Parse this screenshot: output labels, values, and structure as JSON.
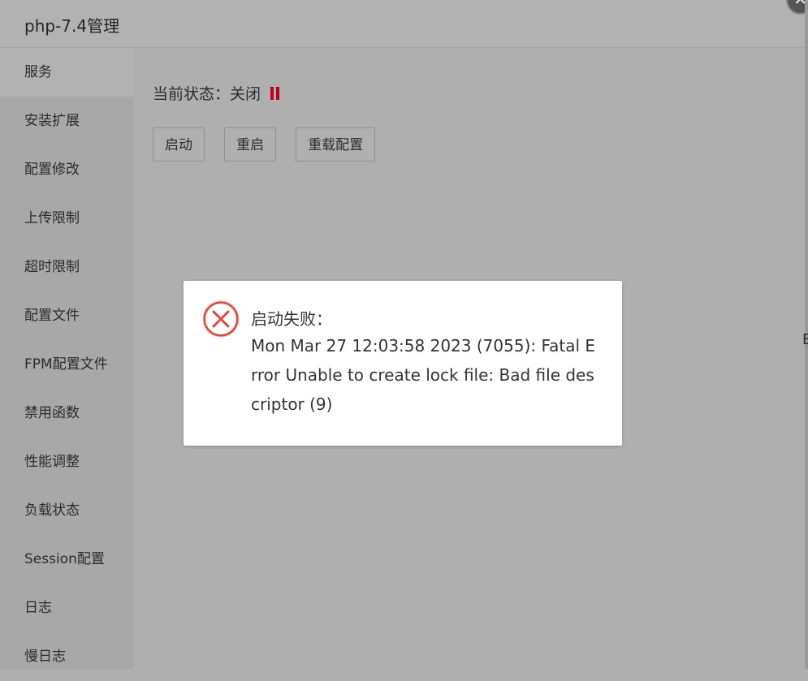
{
  "window": {
    "title": "php-7.4管理",
    "close_symbol": "✕"
  },
  "sidebar": {
    "items": [
      {
        "label": "服务",
        "active": true
      },
      {
        "label": "安装扩展"
      },
      {
        "label": "配置修改"
      },
      {
        "label": "上传限制"
      },
      {
        "label": "超时限制"
      },
      {
        "label": "配置文件"
      },
      {
        "label": "FPM配置文件"
      },
      {
        "label": "禁用函数"
      },
      {
        "label": "性能调整"
      },
      {
        "label": "负载状态"
      },
      {
        "label": "Session配置"
      },
      {
        "label": "日志"
      },
      {
        "label": "慢日志"
      }
    ]
  },
  "main": {
    "status_label": "当前状态：关闭",
    "status_icon": "pause-icon",
    "status_color": "#c0001a",
    "buttons": {
      "start": "启动",
      "restart": "重启",
      "reload": "重载配置"
    }
  },
  "dialog": {
    "icon": "error-circle-icon",
    "icon_color": "#e0463a",
    "title": "启动失败：",
    "message": "Mon Mar 27 12:03:58 2023 (7055): Fatal Error Unable to create lock file: Bad file descriptor (9)"
  },
  "edge_text": "E"
}
